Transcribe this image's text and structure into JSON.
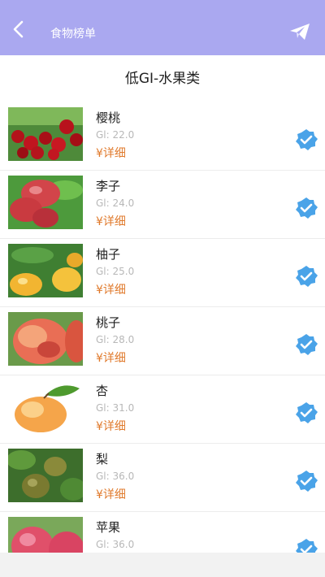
{
  "header": {
    "title": "食物榜单",
    "back_icon": "back-arrow-icon",
    "send_icon": "paper-plane-icon"
  },
  "section": {
    "title": "低GI-水果类"
  },
  "colors": {
    "topbar": "#aaa8f0",
    "accent": "#e07a2c",
    "check": "#4aa3e8"
  },
  "items": [
    {
      "name": "樱桃",
      "gi": "Gl: 22.0",
      "detail": "¥详细",
      "image": "cherry-image"
    },
    {
      "name": "李子",
      "gi": "Gl: 24.0",
      "detail": "¥详细",
      "image": "plum-image"
    },
    {
      "name": "柚子",
      "gi": "Gl: 25.0",
      "detail": "¥详细",
      "image": "pomelo-image"
    },
    {
      "name": "桃子",
      "gi": "Gl: 28.0",
      "detail": "¥详细",
      "image": "peach-image"
    },
    {
      "name": "杏",
      "gi": "Gl: 31.0",
      "detail": "¥详细",
      "image": "apricot-image"
    },
    {
      "name": "梨",
      "gi": "Gl: 36.0",
      "detail": "¥详细",
      "image": "pear-image"
    },
    {
      "name": "苹果",
      "gi": "Gl: 36.0",
      "detail": "",
      "image": "apple-image"
    }
  ]
}
